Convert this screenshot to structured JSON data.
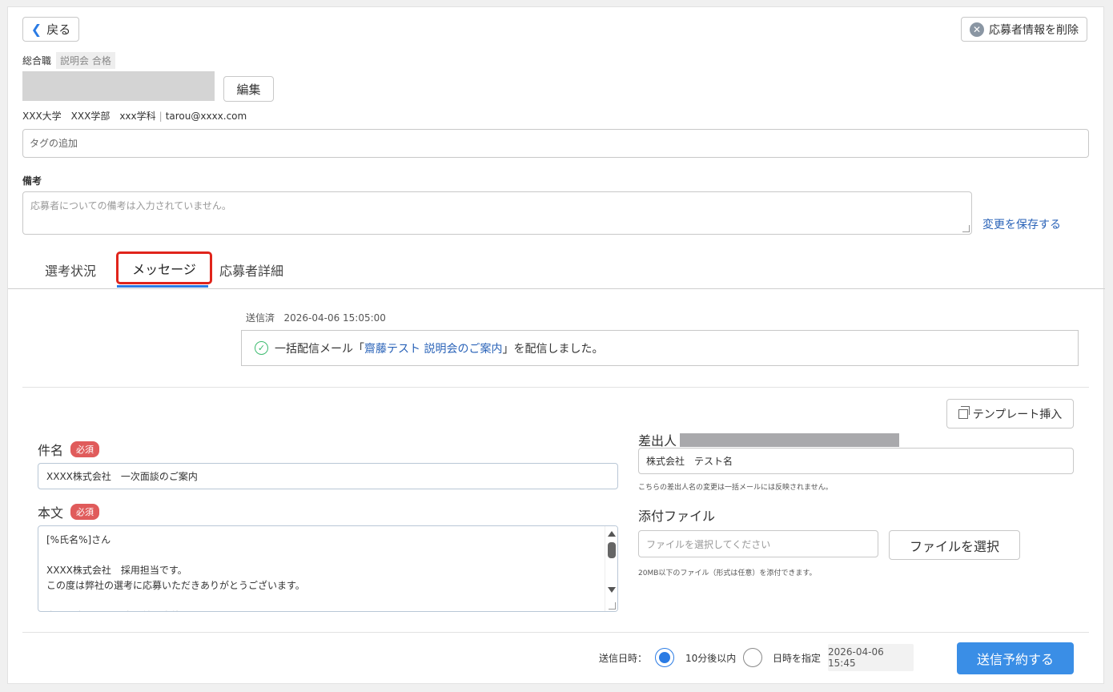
{
  "header": {
    "back_label": "戻る",
    "delete_label": "応募者情報を削除"
  },
  "applicant": {
    "position": "総合職",
    "stage": "説明会 合格",
    "edit_label": "編集",
    "university": "XXX大学　XXX学部　xxx学科",
    "separator": "|",
    "email": "tarou@xxxx.com",
    "tag_placeholder": "タグの追加",
    "remarks_label": "備考",
    "remarks_placeholder": "応募者についての備考は入力されていません。",
    "save_label": "変更を保存する"
  },
  "tabs": [
    {
      "label": "選考状況"
    },
    {
      "label": "メッセージ"
    },
    {
      "label": "応募者詳細"
    }
  ],
  "sent_message": {
    "status": "送信済",
    "datetime": "2026-04-06 15:05:00",
    "text_prefix": "一括配信メール「",
    "link_text": "齋藤テスト 説明会のご案内",
    "text_suffix": "」を配信しました。"
  },
  "compose": {
    "template_label": "テンプレート挿入",
    "subject_label": "件名",
    "required_label": "必須",
    "subject_value": "XXXX株式会社　一次面談のご案内",
    "body_label": "本文",
    "body_value": "[%氏名%]さん\n\nXXXX株式会社　採用担当です。\nこの度は弊社の選考に応募いただきありがとうございます。\n\n次の選考では、一次面談を実施いたします。",
    "sender_label": "差出人",
    "sender_value": "株式会社　テスト名",
    "sender_note": "こちらの差出人名の変更は一括メールには反映されません。",
    "attach_label": "添付ファイル",
    "file_placeholder": "ファイルを選択してください",
    "file_button": "ファイルを選択",
    "file_note": "20MB以下のファイル（形式は任意）を添付できます。"
  },
  "schedule": {
    "label": "送信日時：",
    "option_10min": "10分後以内",
    "option_specify": "日時を指定",
    "date_value": "2026-04-06 15:45",
    "submit_label": "送信予約する"
  },
  "colors": {
    "accent": "#2a7be4",
    "highlight_border": "#e0241b",
    "required_badge": "#e05b5b",
    "success": "#3dbb6f",
    "link": "#2a63b8"
  }
}
